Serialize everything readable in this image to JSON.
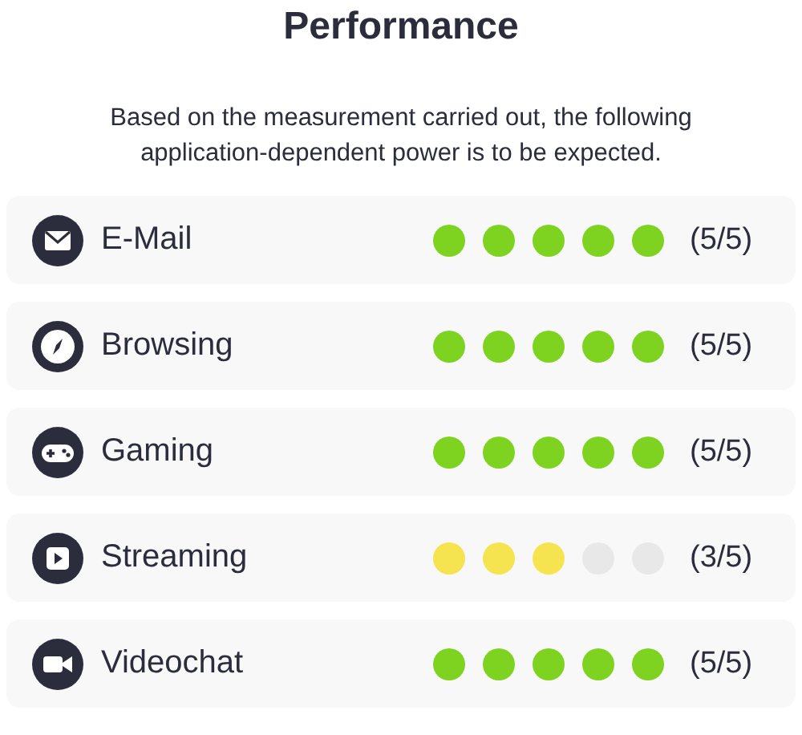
{
  "title": "Performance",
  "description": "Based on the measurement carried out, the following application-dependent power is to be expected.",
  "rows": [
    {
      "kind": "mail",
      "label": "E-Mail",
      "stars": 5,
      "color": "#7ed321",
      "score": "(5/5)"
    },
    {
      "kind": "compass",
      "label": "Browsing",
      "stars": 5,
      "color": "#7ed321",
      "score": "(5/5)"
    },
    {
      "kind": "gamepad",
      "label": "Gaming",
      "stars": 5,
      "color": "#7ed321",
      "score": "(5/5)"
    },
    {
      "kind": "play",
      "label": "Streaming",
      "stars": 3,
      "color": "#f5e44f",
      "score": "(3/5)"
    },
    {
      "kind": "camera",
      "label": "Videochat",
      "stars": 5,
      "color": "#7ed321",
      "score": "(5/5)"
    }
  ]
}
